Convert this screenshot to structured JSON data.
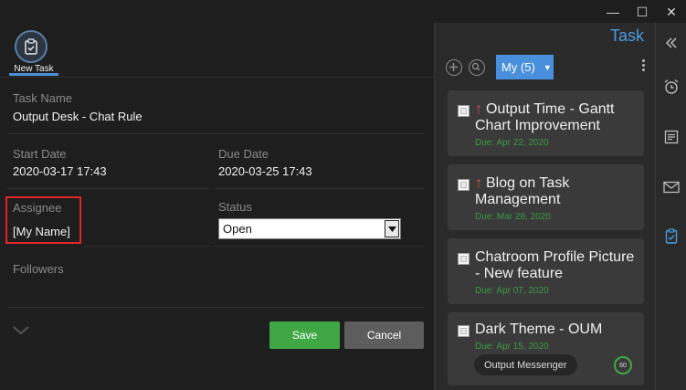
{
  "window": {
    "minimize": "—",
    "maximize": "☐",
    "close": "✕"
  },
  "toolbar": {
    "new_task_label": "New Task"
  },
  "form": {
    "task_name_label": "Task Name",
    "task_name_value": "Output Desk - Chat Rule",
    "start_date_label": "Start Date",
    "start_date_value": "2020-03-17 17:43",
    "due_date_label": "Due Date",
    "due_date_value": "2020-03-25 17:43",
    "assignee_label": "Assignee",
    "assignee_value": "[My Name]",
    "status_label": "Status",
    "status_value": "Open",
    "followers_label": "Followers",
    "save_label": "Save",
    "cancel_label": "Cancel"
  },
  "task_panel": {
    "title": "Task",
    "filter_label": "My (5)",
    "tasks": [
      {
        "title": "Output Time - Gantt Chart Improvement",
        "priority": "↑",
        "due": "Due: Apr 22, 2020"
      },
      {
        "title": "Blog on Task Management",
        "priority": "↑",
        "due": "Due: Mar 28, 2020"
      },
      {
        "title": "Chatroom Profile Picture - New feature",
        "priority": "",
        "due": "Due: Apr 07, 2020"
      },
      {
        "title": "Dark Theme - OUM",
        "priority": "",
        "due": "Due: Apr 15, 2020",
        "tag": "Output Messenger",
        "progress": "60"
      }
    ]
  },
  "colors": {
    "accent": "#4a8fdb",
    "save": "#3fa845",
    "cancel": "#5d5d5d",
    "highlight": "#e0262b",
    "due": "#3c9a44"
  }
}
